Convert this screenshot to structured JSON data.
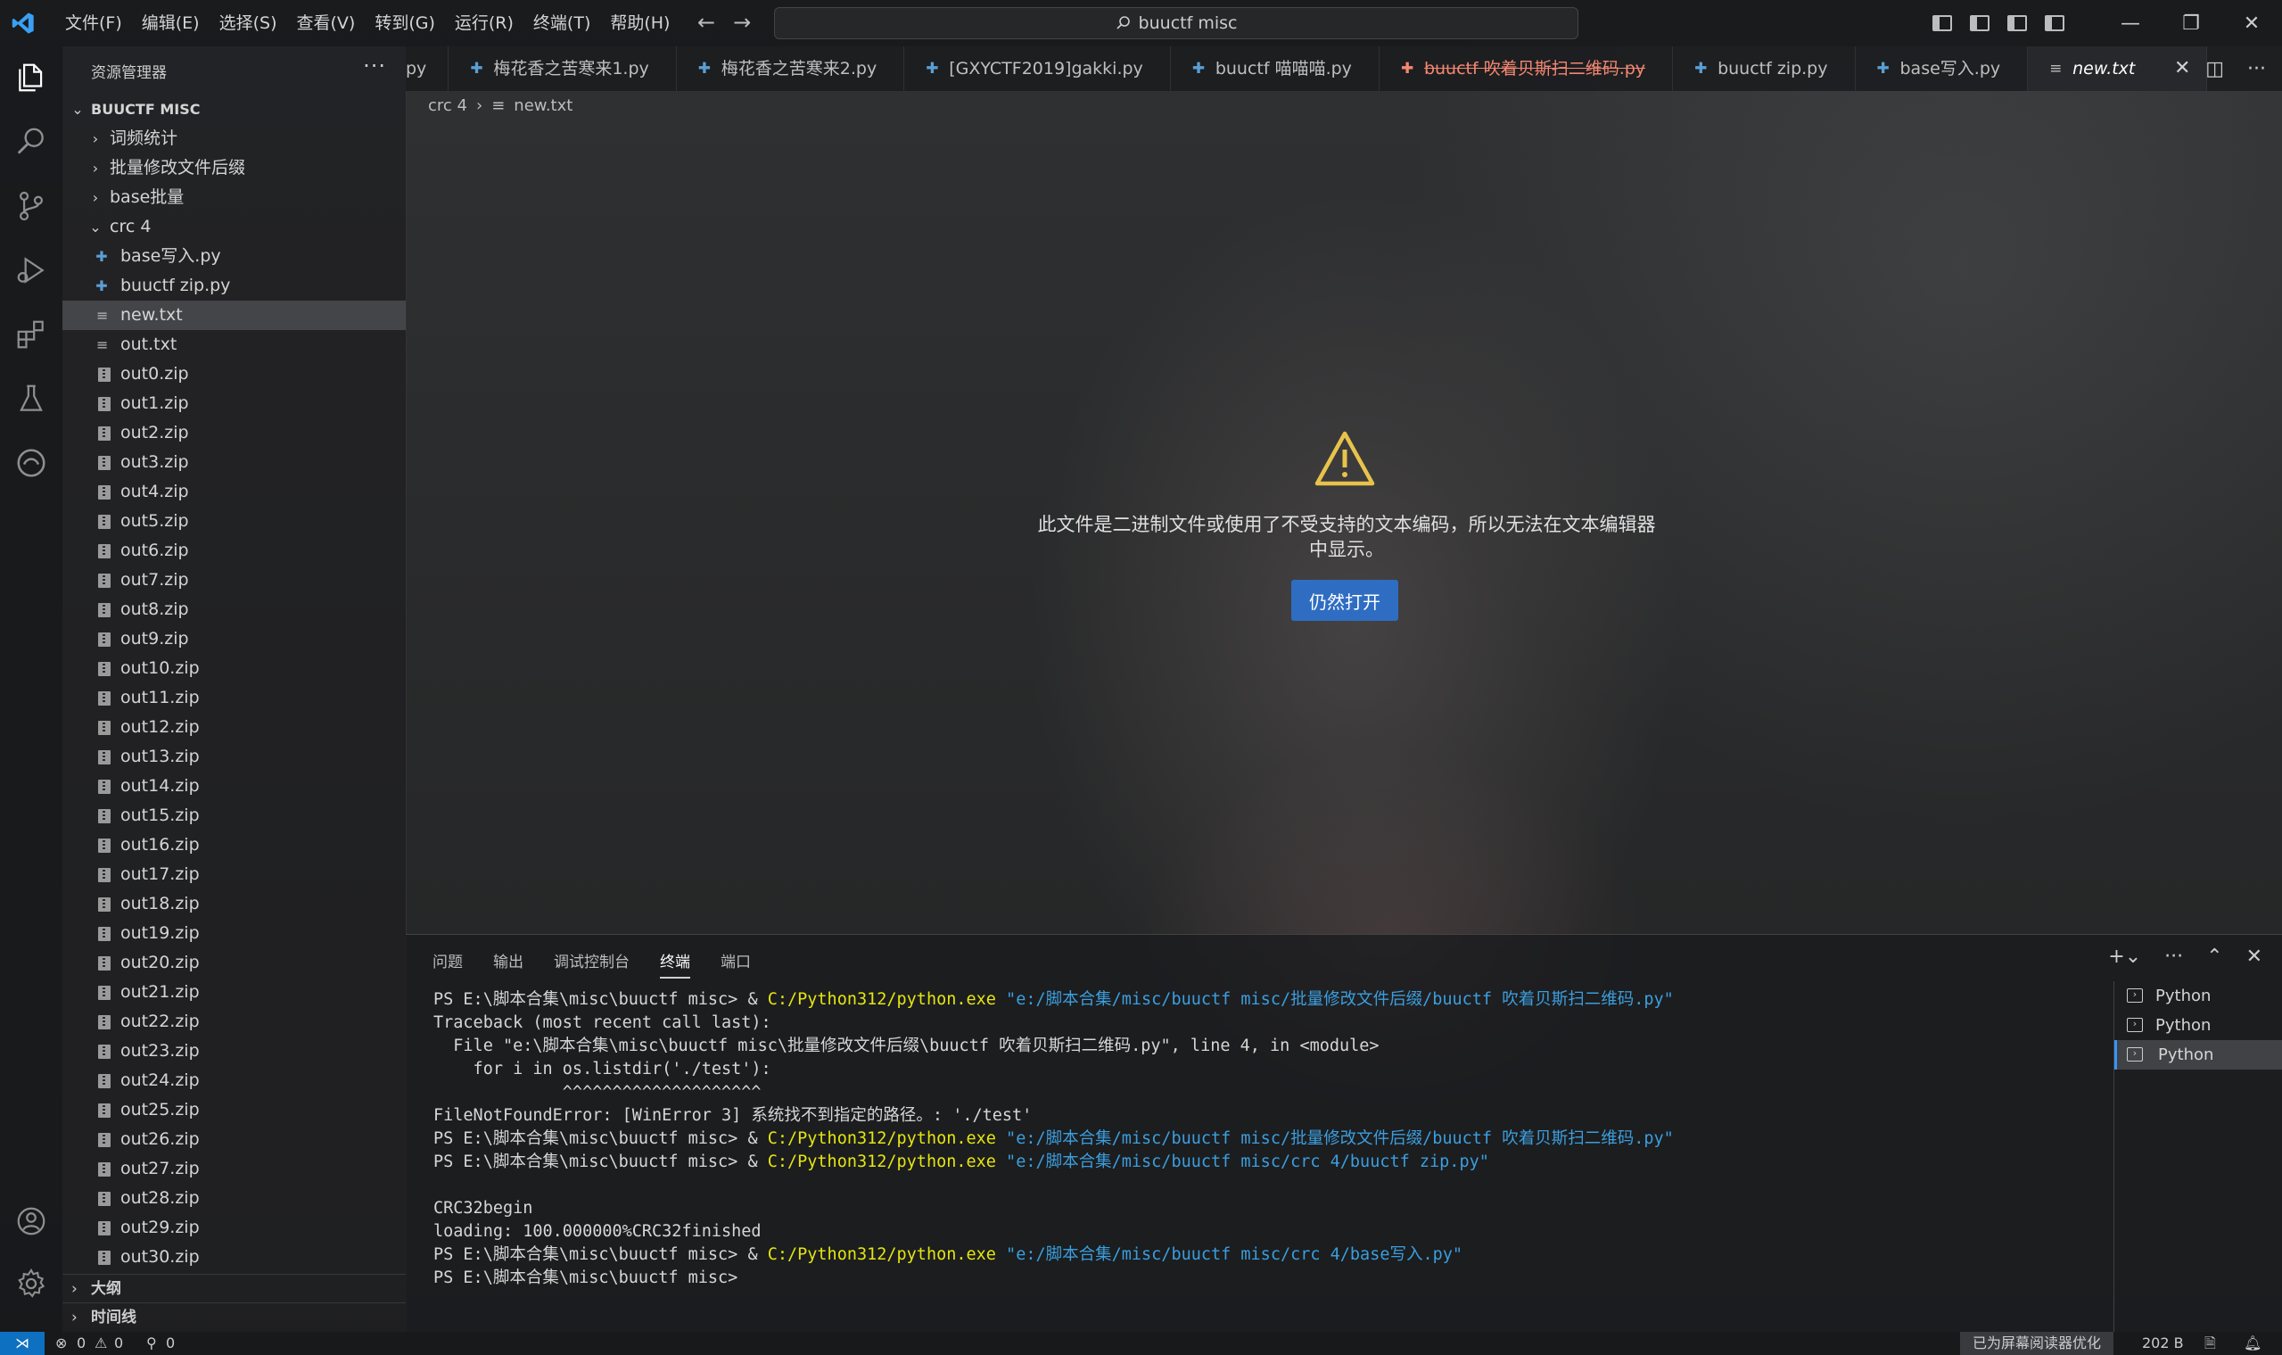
{
  "search": {
    "text": "buuctf misc"
  },
  "menu": [
    "文件(F)",
    "编辑(E)",
    "选择(S)",
    "查看(V)",
    "转到(G)",
    "运行(R)",
    "终端(T)",
    "帮助(H)"
  ],
  "sidebar": {
    "title": "资源管理器",
    "root": "BUUCTF MISC",
    "folders": [
      "词频统计",
      "批量修改文件后缀",
      "base批量"
    ],
    "open_folder": "crc 4",
    "files": [
      "base写入.py",
      "buuctf zip.py",
      "new.txt",
      "out.txt",
      "out0.zip",
      "out1.zip",
      "out2.zip",
      "out3.zip",
      "out4.zip",
      "out5.zip",
      "out6.zip",
      "out7.zip",
      "out8.zip",
      "out9.zip",
      "out10.zip",
      "out11.zip",
      "out12.zip",
      "out13.zip",
      "out14.zip",
      "out15.zip",
      "out16.zip",
      "out17.zip",
      "out18.zip",
      "out19.zip",
      "out20.zip",
      "out21.zip",
      "out22.zip",
      "out23.zip",
      "out24.zip",
      "out25.zip",
      "out26.zip",
      "out27.zip",
      "out28.zip",
      "out29.zip",
      "out30.zip"
    ],
    "outline": "大纲",
    "timeline": "时间线"
  },
  "tabs": {
    "partial": "py",
    "items": [
      "梅花香之苦寒来1.py",
      "梅花香之苦寒来2.py",
      "[GXYCTF2019]gakki.py",
      "buuctf 喵喵喵.py",
      "buuctf 吹着贝斯扫二维码.py",
      "buuctf zip.py",
      "base写入.py"
    ],
    "active": "new.txt"
  },
  "breadcrumb": {
    "folder": "crc 4",
    "file": "new.txt"
  },
  "editor": {
    "message": "此文件是二进制文件或使用了不受支持的文本编码，所以无法在文本编辑器中显示。",
    "open_anyway": "仍然打开"
  },
  "panel": {
    "tabs": [
      "问题",
      "输出",
      "调试控制台",
      "终端",
      "端口"
    ],
    "terminals": [
      "Python",
      "Python",
      "Python"
    ],
    "lines": {
      "l1_prompt": "PS E:\\脚本合集\\misc\\buuctf misc> & ",
      "exe": "C:/Python312/python.exe",
      "l1_path": " \"e:/脚本合集/misc/buuctf misc/批量修改文件后缀/buuctf 吹着贝斯扫二维码.py\"",
      "l2": "Traceback (most recent call last):",
      "l3": "  File \"e:\\脚本合集\\misc\\buuctf misc\\批量修改文件后缀\\buuctf 吹着贝斯扫二维码.py\", line 4, in <module>",
      "l4": "    for i in os.listdir('./test'):",
      "l5": "             ^^^^^^^^^^^^^^^^^^^^",
      "l6": "FileNotFoundError: [WinError 3] 系统找不到指定的路径。: './test'",
      "l8_path": " \"e:/脚本合集/misc/buuctf misc/crc 4/buuctf zip.py\"",
      "l10": "CRC32begin",
      "l11": "loading: 100.000000%CRC32finished",
      "l12_path": " \"e:/脚本合集/misc/buuctf misc/crc 4/base写入.py\"",
      "l13": "PS E:\\脚本合集\\misc\\buuctf misc>"
    }
  },
  "status": {
    "errors": "0",
    "warnings": "0",
    "ports": "0",
    "screen_reader": "已为屏幕阅读器优化",
    "size": "202 B"
  }
}
